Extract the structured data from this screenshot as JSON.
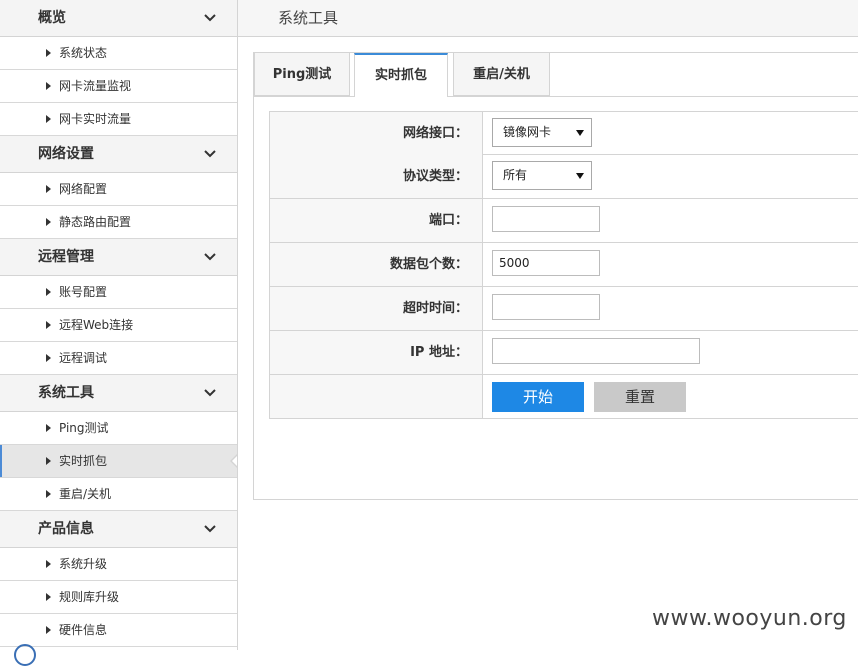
{
  "header": {
    "title": "系统工具"
  },
  "sidebar": {
    "sections": [
      {
        "title": "概览",
        "items": [
          "系统状态",
          "网卡流量监视",
          "网卡实时流量"
        ]
      },
      {
        "title": "网络设置",
        "items": [
          "网络配置",
          "静态路由配置"
        ]
      },
      {
        "title": "远程管理",
        "items": [
          "账号配置",
          "远程Web连接",
          "远程调试"
        ]
      },
      {
        "title": "系统工具",
        "items": [
          "Ping测试",
          "实时抓包",
          "重启/关机"
        ]
      },
      {
        "title": "产品信息",
        "items": [
          "系统升级",
          "规则库升级",
          "硬件信息"
        ]
      }
    ],
    "active_item": "实时抓包"
  },
  "tabs": [
    {
      "label": "Ping测试",
      "active": false
    },
    {
      "label": "实时抓包",
      "active": true
    },
    {
      "label": "重启/关机",
      "active": false
    }
  ],
  "form": {
    "interface_label": "网络接口：",
    "interface_value": "镜像网卡",
    "protocol_label": "协议类型：",
    "protocol_value": "所有",
    "port_label": "端口：",
    "port_value": "",
    "count_label": "数据包个数：",
    "count_value": "5000",
    "timeout_label": "超时时间：",
    "timeout_value": "",
    "ip_label": "IP 地址：",
    "ip_value": "",
    "start_label": "开始",
    "reset_label": "重置"
  },
  "watermark": "www.wooyun.org",
  "colors": {
    "accent": "#1e88e5",
    "active_tab_border": "#3b8bd8",
    "reset_button": "#c9c9c9"
  }
}
